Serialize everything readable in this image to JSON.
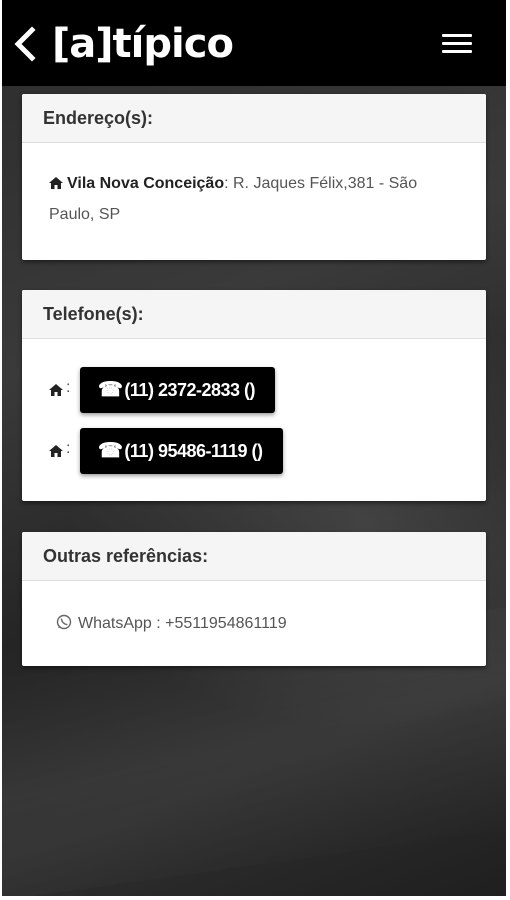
{
  "header": {
    "logo_text": "[a]típico",
    "back_icon": "chevron-left-icon",
    "menu_icon": "hamburger-menu-icon"
  },
  "address_card": {
    "title": "Endereço(s):",
    "neighborhood": "Vila Nova Conceição",
    "street": ": R. Jaques Félix,381 - São Paulo, SP",
    "icon": "home-icon"
  },
  "phones_card": {
    "title": "Telefone(s):",
    "separator": ":",
    "phones": [
      {
        "label": "(11) 2372-2833 ()",
        "icon": "home-icon"
      },
      {
        "label": "(11) 95486-1119 ()",
        "icon": "home-icon"
      }
    ],
    "button_icon": "telephone-icon",
    "button_icon_glyph": "☎"
  },
  "refs_card": {
    "title": "Outras referências:",
    "whatsapp": "WhatsApp : +5511954861119",
    "icon": "whatsapp-icon"
  },
  "colors": {
    "topbar": "#000000",
    "card_header_bg": "#f5f5f5",
    "button_bg": "#000000",
    "background": "#2c2c2c"
  }
}
